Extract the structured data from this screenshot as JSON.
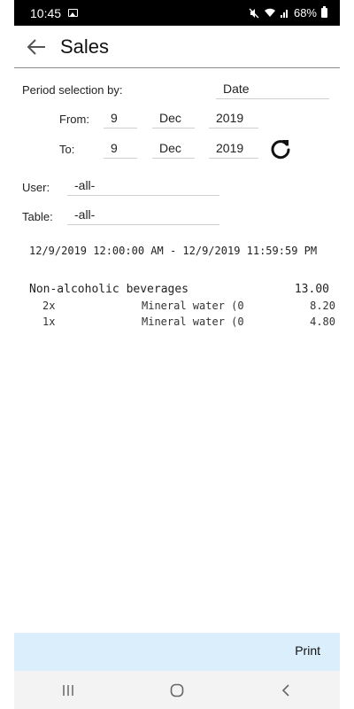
{
  "status": {
    "time": "10:45",
    "battery": "68%"
  },
  "header": {
    "title": "Sales"
  },
  "period": {
    "label": "Period selection by:",
    "mode": "Date",
    "from_label": "From:",
    "from": {
      "day": "9",
      "month": "Dec",
      "year": "2019"
    },
    "to_label": "To:",
    "to": {
      "day": "9",
      "month": "Dec",
      "year": "2019"
    }
  },
  "filters": {
    "user_label": "User:",
    "user_value": "-all-",
    "table_label": "Table:",
    "table_value": "-all-"
  },
  "report": {
    "range": "12/9/2019 12:00:00 AM - 12/9/2019 11:59:59 PM",
    "category": {
      "name": "Non-alcoholic beverages",
      "total": "13.00"
    },
    "items": [
      {
        "qty": "2x",
        "name": "Mineral water (0",
        "price": "8.20"
      },
      {
        "qty": "1x",
        "name": "Mineral water (0",
        "price": "4.80"
      }
    ]
  },
  "footer": {
    "print_label": "Print"
  }
}
